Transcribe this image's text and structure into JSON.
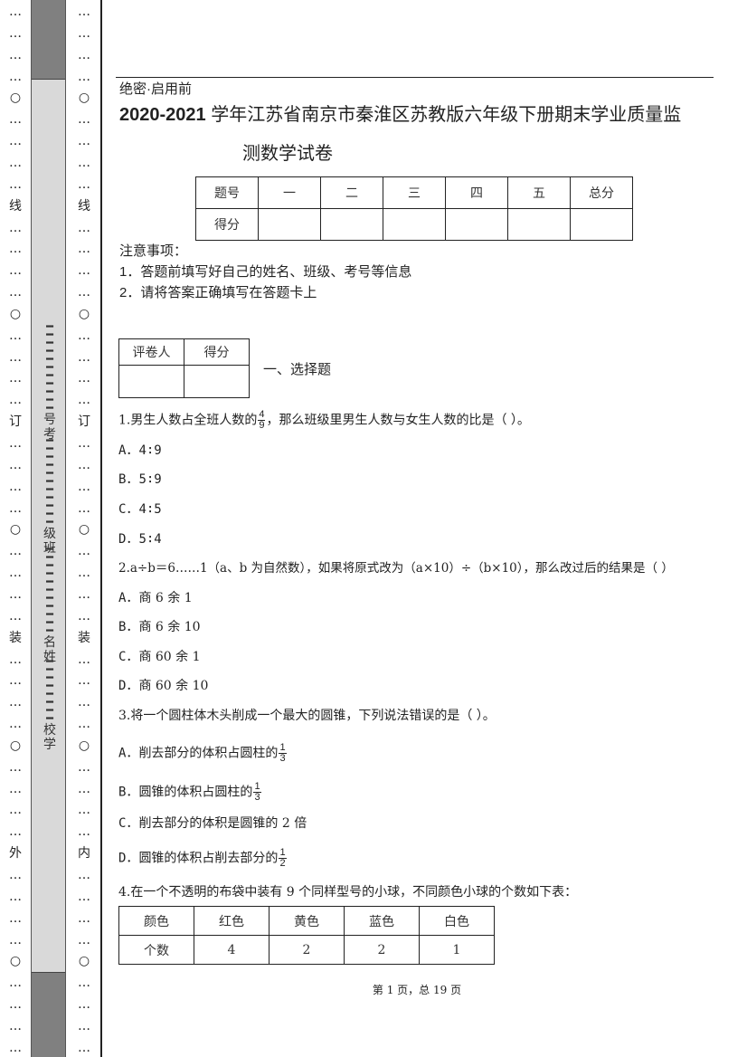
{
  "binding_margin": {
    "left_column_marks": [
      "…",
      "…",
      "…",
      "…",
      "○",
      "…",
      "…",
      "…",
      "…",
      "线",
      "…",
      "…",
      "…",
      "…",
      "○",
      "…",
      "…",
      "…",
      "…",
      "订",
      "…",
      "…",
      "…",
      "…",
      "○",
      "…",
      "…",
      "…",
      "…",
      "装",
      "…",
      "…",
      "…",
      "…",
      "○",
      "…",
      "…",
      "…",
      "…",
      "外",
      "…",
      "…",
      "…",
      "…",
      "○",
      "…",
      "…",
      "…",
      "…"
    ],
    "right_column_marks": [
      "…",
      "…",
      "…",
      "…",
      "○",
      "…",
      "…",
      "…",
      "…",
      "线",
      "…",
      "…",
      "…",
      "…",
      "○",
      "…",
      "…",
      "…",
      "…",
      "订",
      "…",
      "…",
      "…",
      "…",
      "○",
      "…",
      "…",
      "…",
      "…",
      "装",
      "…",
      "…",
      "…",
      "…",
      "○",
      "…",
      "…",
      "…",
      "…",
      "内",
      "…",
      "…",
      "…",
      "…",
      "○",
      "…",
      "…",
      "…",
      "…"
    ],
    "fields": [
      {
        "label_top": "号",
        "label_bottom": "考"
      },
      {
        "label_top": "级",
        "label_bottom": "班"
      },
      {
        "label_top": "名",
        "label_bottom": "姓"
      },
      {
        "label_top": "校",
        "label_bottom": "学"
      }
    ]
  },
  "header": {
    "secret_label": "绝密·启用前",
    "title_year": "2020-2021",
    "title_line1": " 学年江苏省南京市秦淮区苏教版六年级下册期末学业质量监",
    "title_line2": "测数学试卷"
  },
  "score_table": {
    "header_row": [
      "题号",
      "一",
      "二",
      "三",
      "四",
      "五",
      "总分"
    ],
    "score_row": [
      "得分",
      "",
      "",
      "",
      "",
      "",
      ""
    ]
  },
  "notes": {
    "heading": "注意事项：",
    "items": [
      "1．答题前填写好自己的姓名、班级、考号等信息",
      "2．请将答案正确填写在答题卡上"
    ]
  },
  "grader_table": {
    "headers": [
      "评卷人",
      "得分"
    ],
    "values": [
      "",
      ""
    ]
  },
  "section_title": "一、选择题",
  "questions": [
    {
      "stem_before": "1.男生人数占全班人数的",
      "fraction": {
        "num": "4",
        "den": "9"
      },
      "stem_after": "，那么班级里男生人数与女生人数的比是（ ）。",
      "options": [
        {
          "key": "A．",
          "text": "4∶9"
        },
        {
          "key": "B．",
          "text": "5∶9"
        },
        {
          "key": "C．",
          "text": "4∶5"
        },
        {
          "key": "D．",
          "text": "5∶4"
        }
      ]
    },
    {
      "stem": "2.a÷b＝6……1（a、b 为自然数），如果将原式改为（a×10）÷（b×10），那么改过后的结果是（ ）",
      "options": [
        {
          "key": "A．",
          "text": "商 6 余 1"
        },
        {
          "key": "B．",
          "text": "商 6 余 10"
        },
        {
          "key": "C．",
          "text": "商 60 余 1"
        },
        {
          "key": "D．",
          "text": "商 60 余 10"
        }
      ]
    },
    {
      "stem": "3.将一个圆柱体木头削成一个最大的圆锥，下列说法错误的是（ ）。",
      "options": [
        {
          "key": "A．",
          "text": "削去部分的体积占圆柱的",
          "fraction": {
            "num": "1",
            "den": "3"
          }
        },
        {
          "key": "B．",
          "text": "圆锥的体积占圆柱的",
          "fraction": {
            "num": "1",
            "den": "3"
          }
        },
        {
          "key": "C．",
          "text": "削去部分的体积是圆锥的 2 倍"
        },
        {
          "key": "D．",
          "text": "圆锥的体积占削去部分的",
          "fraction": {
            "num": "1",
            "den": "2"
          }
        }
      ]
    },
    {
      "stem": "4.在一个不透明的布袋中装有 9 个同样型号的小球，不同颜色小球的个数如下表：",
      "table": {
        "header_row": [
          "颜色",
          "红色",
          "黄色",
          "蓝色",
          "白色"
        ],
        "value_row": [
          "个数",
          "4",
          "2",
          "2",
          "1"
        ]
      }
    }
  ],
  "footer": "第 1 页，总 19 页"
}
